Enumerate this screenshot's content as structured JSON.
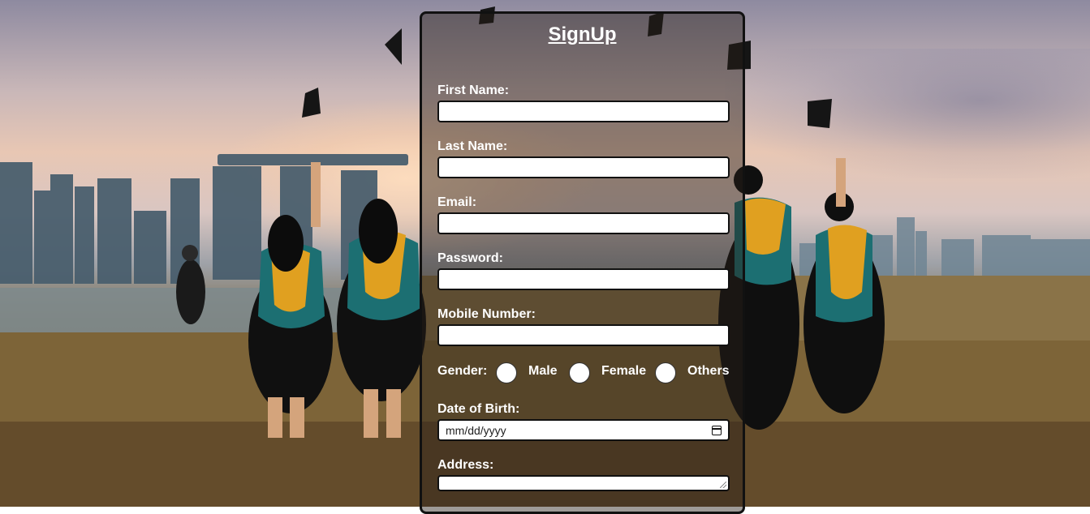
{
  "form": {
    "title": "SignUp",
    "first_name_label": "First Name:",
    "last_name_label": "Last Name:",
    "email_label": "Email:",
    "password_label": "Password:",
    "mobile_label": "Mobile Number:",
    "gender_label": "Gender:",
    "gender_options": [
      "Male",
      "Female",
      "Others"
    ],
    "dob_label": "Date of Birth:",
    "dob_placeholder": "mm/dd/yyyy",
    "address_label": "Address:"
  },
  "colors": {
    "panel_border": "#111111",
    "text": "#ffffff",
    "field_bg": "#ffffff"
  },
  "icons": {
    "calendar": "calendar-icon",
    "resize": "resize-grip-icon"
  }
}
